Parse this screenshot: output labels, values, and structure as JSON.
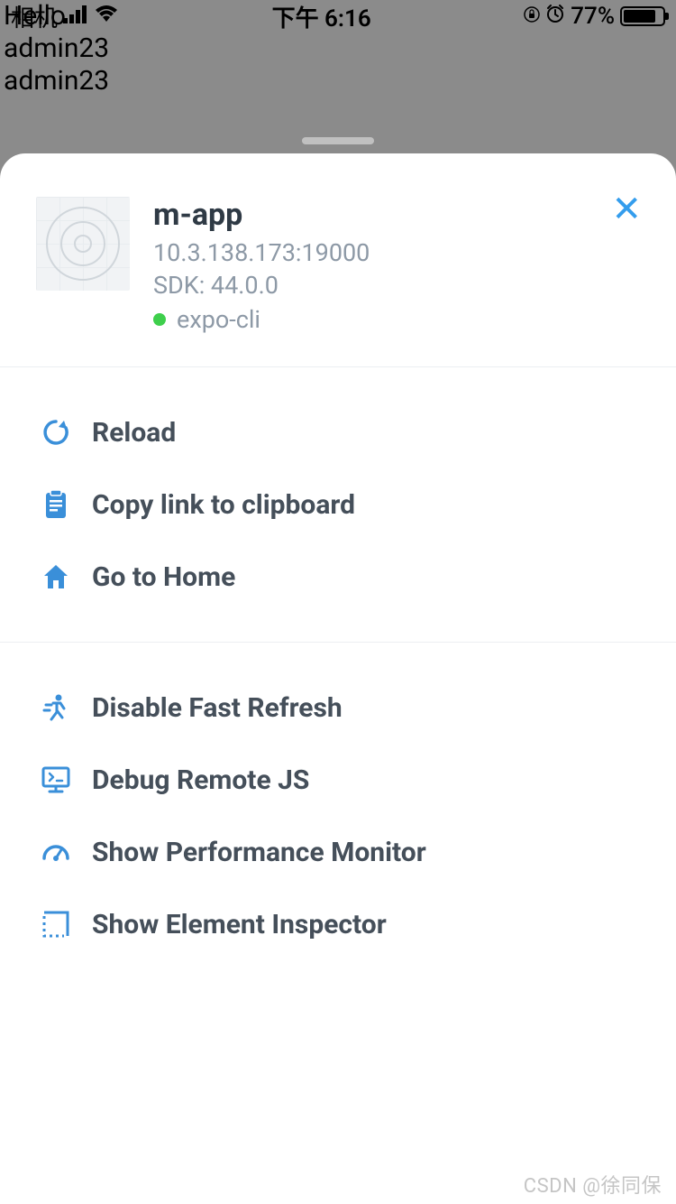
{
  "background": {
    "line1": "Hello",
    "line2": "admin23",
    "line3": "admin23"
  },
  "status_bar": {
    "carrier": "相机",
    "time": "下午 6:16",
    "battery_pct": "77%"
  },
  "sheet": {
    "close": "✕",
    "app": {
      "title": "m-app",
      "host": "10.3.138.173:19000",
      "sdk_label": "SDK: 44.0.0",
      "status_label": "expo-cli",
      "status_color": "#3ecf4c"
    },
    "section1": [
      {
        "icon": "reload-icon",
        "label": "Reload"
      },
      {
        "icon": "clipboard-icon",
        "label": "Copy link to clipboard"
      },
      {
        "icon": "home-icon",
        "label": "Go to Home"
      }
    ],
    "section2": [
      {
        "icon": "run-icon",
        "label": "Disable Fast Refresh"
      },
      {
        "icon": "monitor-debug-icon",
        "label": "Debug Remote JS"
      },
      {
        "icon": "gauge-icon",
        "label": "Show Performance Monitor"
      },
      {
        "icon": "inspector-icon",
        "label": "Show Element Inspector"
      }
    ]
  },
  "watermark": "CSDN @徐同保"
}
